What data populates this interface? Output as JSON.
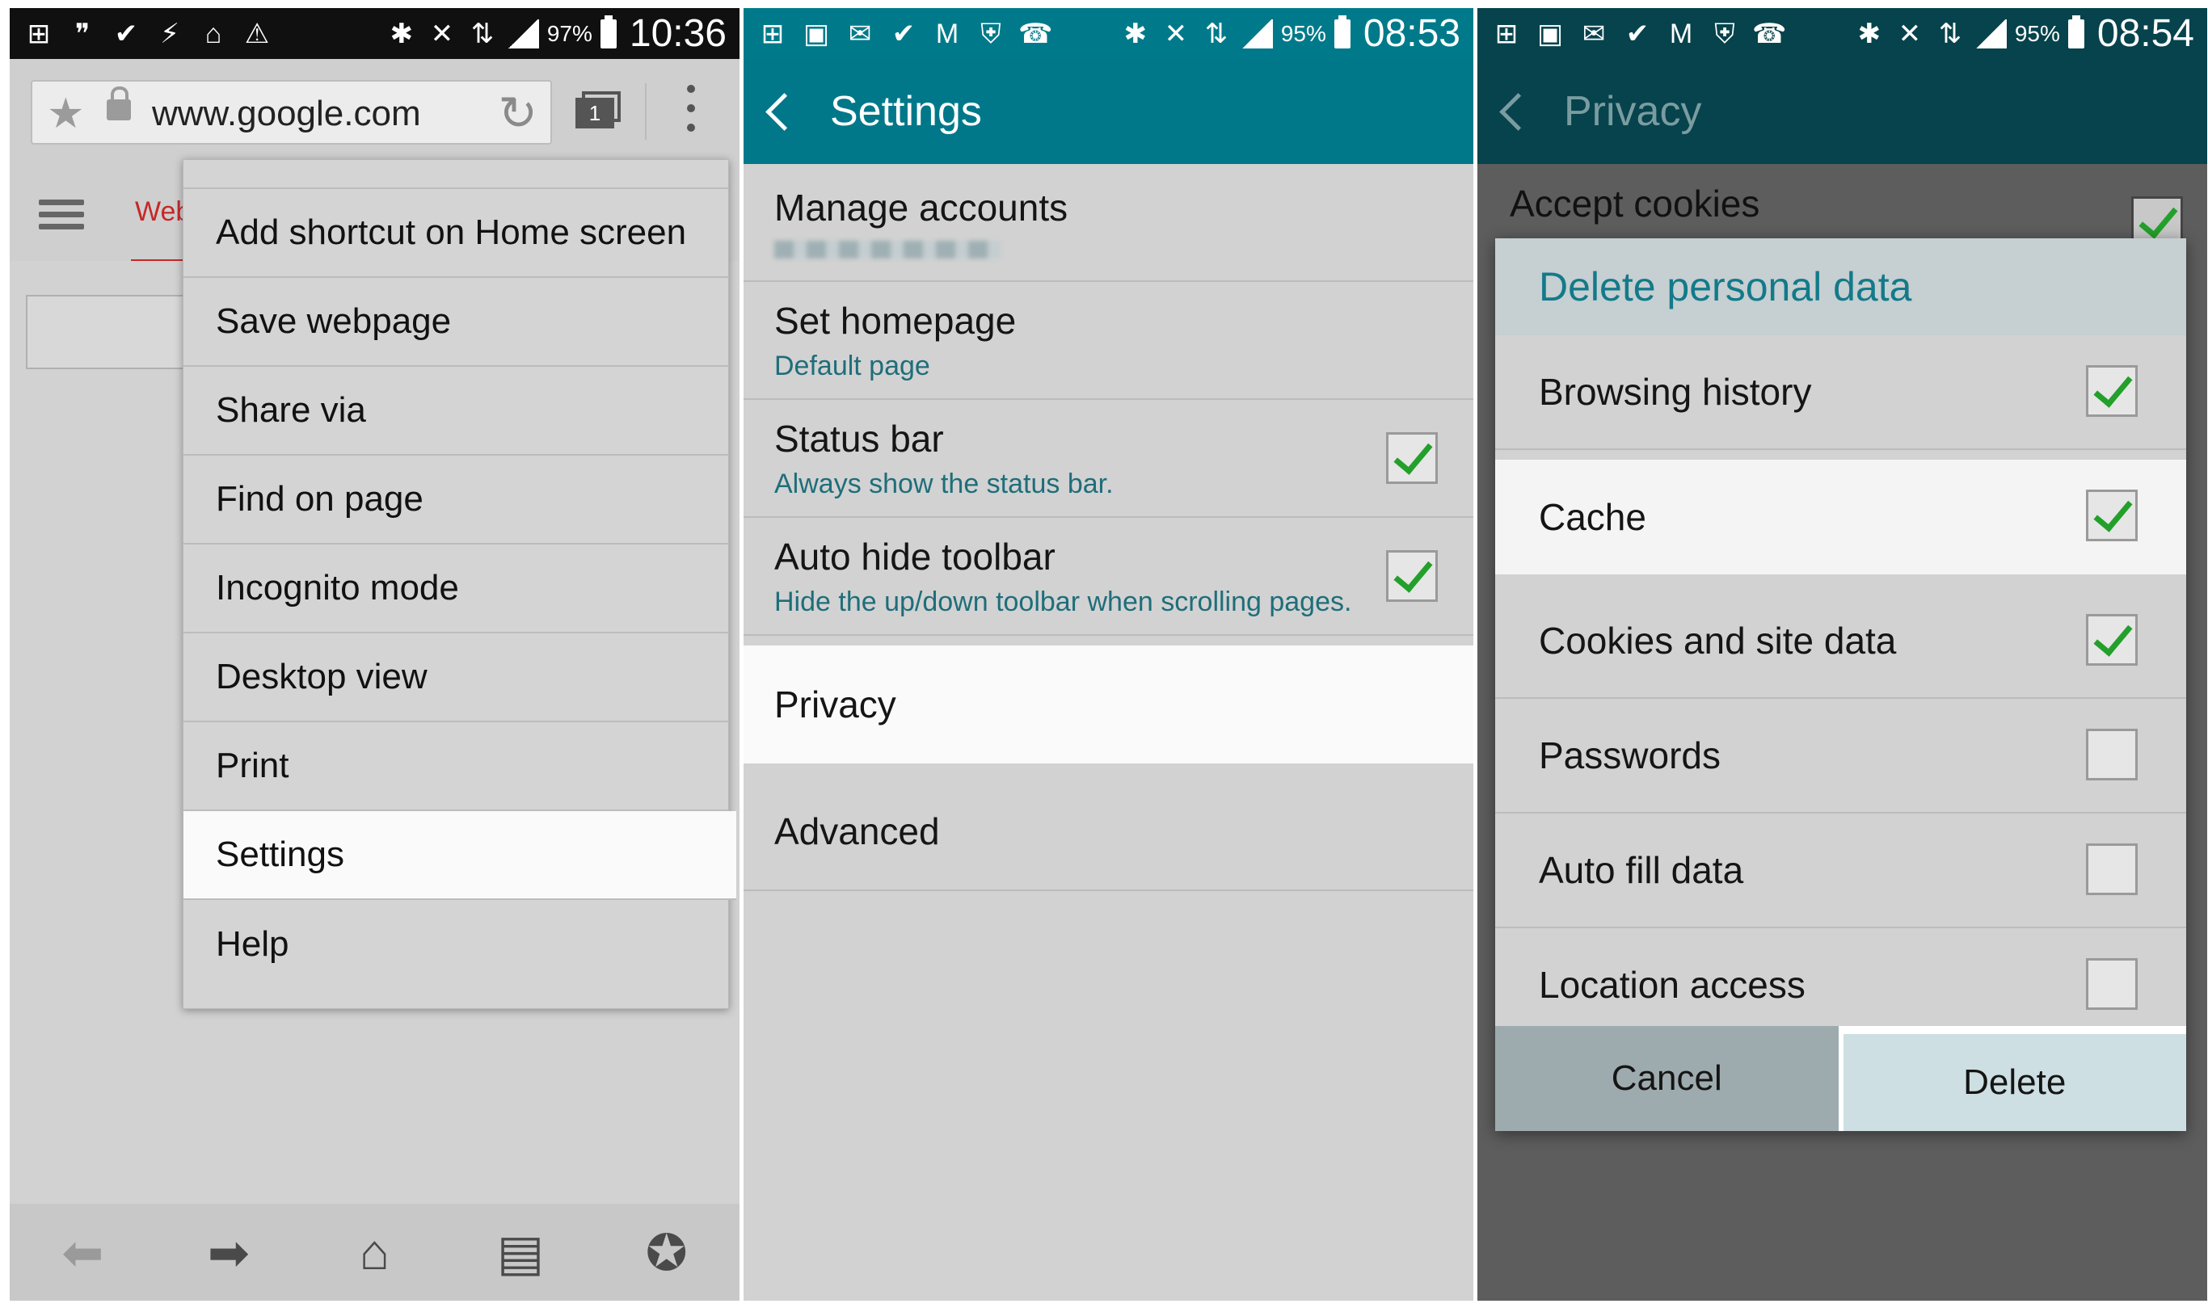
{
  "colors": {
    "accent_teal": "#00788a",
    "dark_teal": "#06434c",
    "check_green": "#23a02b",
    "tab_red": "#c62828"
  },
  "panel1": {
    "status": {
      "battery": "97%",
      "time": "10:36"
    },
    "url": "www.google.com",
    "tab_count": "1",
    "tab_label": "Web",
    "menu_items": [
      "Add shortcut on Home screen",
      "Save webpage",
      "Share via",
      "Find on page",
      "Incognito mode",
      "Desktop view",
      "Print",
      "Settings",
      "Help"
    ],
    "highlighted_menu_item": "Settings",
    "icons": {
      "bookmark": "star-icon",
      "secure": "lock-icon",
      "reload": "reload-icon",
      "tabs": "tabs-icon",
      "more": "more-icon",
      "menu": "hamburger-icon",
      "back": "back-arrow-icon",
      "forward": "forward-arrow-icon",
      "home": "home-icon",
      "saved_pages": "saved-pages-icon",
      "bookmarks": "bookmarks-icon"
    }
  },
  "panel2": {
    "status": {
      "battery": "95%",
      "time": "08:53"
    },
    "title": "Settings",
    "rows": [
      {
        "title": "Manage accounts",
        "sub": "",
        "checked": null
      },
      {
        "title": "Set homepage",
        "sub": "Default page",
        "checked": null
      },
      {
        "title": "Status bar",
        "sub": "Always show the status bar.",
        "checked": true
      },
      {
        "title": "Auto hide toolbar",
        "sub": "Hide the up/down toolbar when scrolling pages.",
        "checked": true
      },
      {
        "title": "Privacy",
        "sub": "",
        "checked": null
      },
      {
        "title": "Advanced",
        "sub": "",
        "checked": null
      }
    ]
  },
  "panel3": {
    "status": {
      "battery": "95%",
      "time": "08:54"
    },
    "title": "Privacy",
    "background_row": {
      "title": "Accept cookies",
      "checked": true
    },
    "dialog": {
      "title": "Delete personal data",
      "items": [
        {
          "label": "Browsing history",
          "checked": true
        },
        {
          "label": "Cache",
          "checked": true
        },
        {
          "label": "Cookies and site data",
          "checked": true
        },
        {
          "label": "Passwords",
          "checked": false
        },
        {
          "label": "Auto fill data",
          "checked": false
        },
        {
          "label": "Location access",
          "checked": false
        }
      ],
      "cancel_label": "Cancel",
      "delete_label": "Delete"
    }
  }
}
